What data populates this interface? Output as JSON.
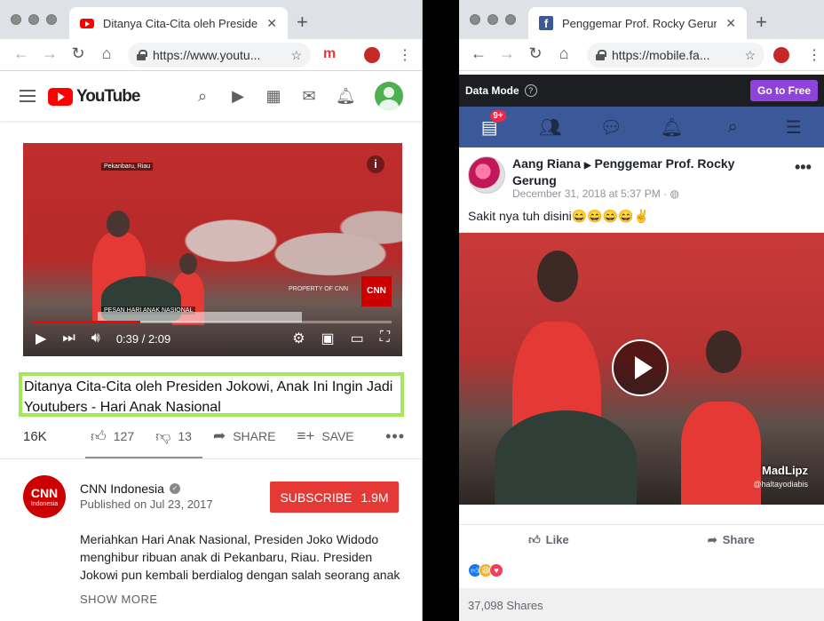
{
  "left_browser": {
    "tab_title": "Ditanya Cita-Cita oleh Presiden",
    "url": "https://www.youtu...",
    "youtube": {
      "logo_text": "YouTube",
      "video": {
        "overlay_location": "Pekanbaru, Riau",
        "overlay_caption": "PESAN HARI ANAK NASIONAL",
        "watermark": "PROPERTY OF CNN",
        "badge": "CNN",
        "time": "0:39 / 2:09",
        "progress": 0.3
      },
      "title": "Ditanya Cita-Cita oleh Presiden Jokowi, Anak Ini Ingin Jadi Youtubers - Hari Anak Nasional",
      "views": "16K",
      "likes": "127",
      "dislikes": "13",
      "share_label": "SHARE",
      "save_label": "SAVE",
      "channel": {
        "logo_text": "CNN",
        "logo_sub": "Indonesia",
        "name": "CNN Indonesia",
        "published": "Published on Jul 23, 2017",
        "subscribe_label": "SUBSCRIBE",
        "subscriber_count": "1.9M"
      },
      "description": "Meriahkan Hari Anak Nasional, Presiden Joko Widodo menghibur ribuan anak di Pekanbaru, Riau. Presiden Jokowi pun kembali berdialog dengan salah seorang anak",
      "show_more": "SHOW MORE"
    }
  },
  "right_browser": {
    "tab_title": "Penggemar Prof. Rocky Gerung",
    "url": "https://mobile.fa...",
    "facebook": {
      "data_mode_label": "Data Mode",
      "go_free_label": "Go to Free",
      "notification_badge": "9+",
      "post": {
        "author": "Aang Riana",
        "group": "Penggemar Prof. Rocky Gerung",
        "date": "December 31, 2018 at 5:37 PM",
        "text": "Sakit nya tuh disini😄😄😄😄✌",
        "watermark": "MadLipz",
        "watermark_handle": "@haltayodiabis",
        "like_label": "Like",
        "share_label": "Share",
        "shares": "37,098 Shares"
      }
    }
  },
  "colors": {
    "youtube_red": "#ff0000",
    "subscribe_red": "#e53935",
    "highlight_green": "#a3e85a",
    "facebook_blue": "#3b5998",
    "go_free_purple": "#8e44d9"
  }
}
